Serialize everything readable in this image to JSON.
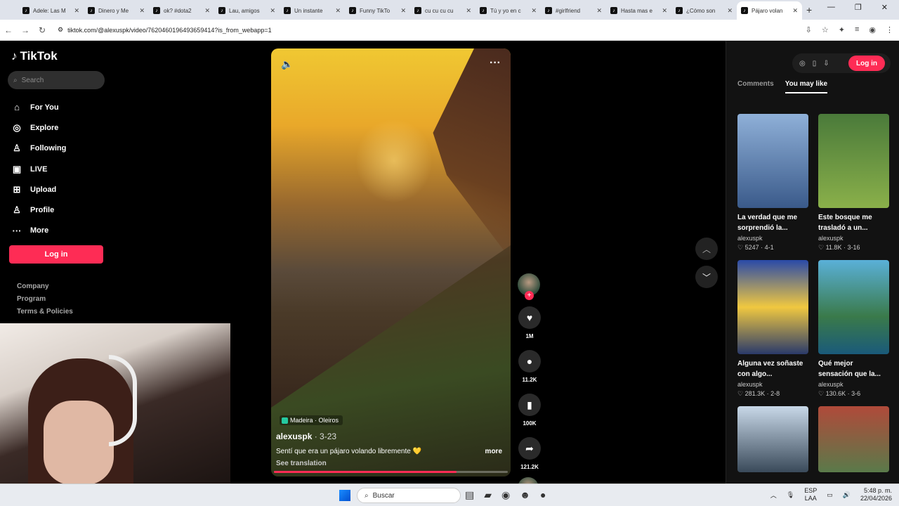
{
  "browser": {
    "tabs": [
      {
        "label": "Adele: Las M"
      },
      {
        "label": "Dinero y Me"
      },
      {
        "label": "ok? #dota2"
      },
      {
        "label": "Lau, amigos"
      },
      {
        "label": "Un instante"
      },
      {
        "label": "Funny TikTo"
      },
      {
        "label": "cu cu cu cu"
      },
      {
        "label": "Tú y yo en c"
      },
      {
        "label": "#girlfriend"
      },
      {
        "label": "Hasta mas e"
      },
      {
        "label": "¿Cómo son"
      },
      {
        "label": "Pájaro volan"
      }
    ],
    "url": "tiktok.com/@alexuspk/video/7620460196493659414?is_from_webapp=1"
  },
  "sidebar": {
    "logo": "TikTok",
    "search_placeholder": "Search",
    "items": [
      {
        "label": "For You",
        "icon": "home-icon"
      },
      {
        "label": "Explore",
        "icon": "compass-icon"
      },
      {
        "label": "Following",
        "icon": "following-icon"
      },
      {
        "label": "LIVE",
        "icon": "live-icon"
      },
      {
        "label": "Upload",
        "icon": "upload-icon"
      },
      {
        "label": "Profile",
        "icon": "profile-icon"
      },
      {
        "label": "More",
        "icon": "more-icon"
      }
    ],
    "login": "Log in",
    "footer": [
      "Company",
      "Program",
      "Terms & Policies"
    ]
  },
  "video": {
    "location": "Madeira · Oleiros",
    "author": "alexuspk",
    "date": "· 3-23",
    "caption": "Sentí que era un pájaro volando libremente 💛",
    "more": "more",
    "see_translation": "See translation",
    "progress": 0.78,
    "likes": "1M",
    "comments": "11.2K",
    "saves": "100K",
    "shares": "121.2K"
  },
  "right_panel": {
    "login": "Log in",
    "tabs": [
      "Comments",
      "You may like"
    ],
    "cards": [
      {
        "title": "La verdad que me sorprendió la...",
        "author": "alexuspk",
        "likes": "5247",
        "date": "4-1"
      },
      {
        "title": "Este bosque me trasladó a un...",
        "author": "alexuspk",
        "likes": "11.8K",
        "date": "3-16"
      },
      {
        "title": "Alguna vez soñaste con algo...",
        "author": "alexuspk",
        "likes": "281.3K",
        "date": "2-8"
      },
      {
        "title": "Qué mejor sensación que la...",
        "author": "alexuspk",
        "likes": "130.6K",
        "date": "3-6"
      },
      {
        "title": "",
        "author": "",
        "likes": "",
        "date": ""
      },
      {
        "title": "",
        "author": "",
        "likes": "",
        "date": ""
      }
    ]
  },
  "taskbar": {
    "search": "Buscar",
    "lang": "ESP",
    "lang2": "LAA",
    "time": "5:48 p. m.",
    "date": "22/04/2026"
  }
}
